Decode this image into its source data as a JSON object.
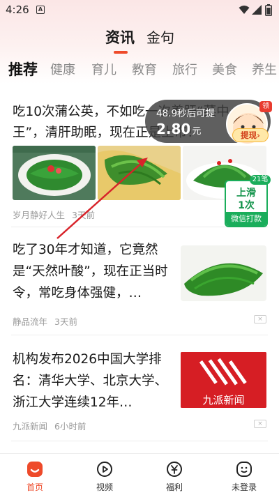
{
  "status_bar": {
    "time": "4:26",
    "notification_letter": "A"
  },
  "header": {
    "tabs": [
      "资讯",
      "金句"
    ],
    "active_tab": "资讯"
  },
  "categories": [
    "推荐",
    "健康",
    "育儿",
    "教育",
    "旅行",
    "美食",
    "养生"
  ],
  "active_category": "推荐",
  "articles": [
    {
      "title": "吃10次蒲公英，不如吃一次养肝“菜中王”，清肝助眠，现在正是上市！",
      "source": "岁月静好人生",
      "time": "3天前"
    },
    {
      "title": "吃了30年才知道，它竟然是“天然叶酸”，现在正当时令，常吃身体强健，…",
      "source": "静品流年",
      "time": "3天前",
      "close_label": "×"
    },
    {
      "title": "机构发布2026中国大学排名：清华大学、北京大学、浙江大学连续12年…",
      "source": "九派新闻",
      "time": "6小时前",
      "close_label": "×",
      "thumb_text": "九派新闻"
    }
  ],
  "timer_overlay": {
    "countdown_text": "48.9秒后可提",
    "amount": "2.80",
    "unit": "元",
    "badge": "领",
    "withdraw_label": "提现",
    "withdraw_arrow": "›"
  },
  "slide_card": {
    "count": "21笔",
    "line1": "上滑",
    "line2": "1次",
    "footer": "微信打款"
  },
  "bottom_nav": [
    {
      "label": "首页",
      "icon": "home-icon",
      "active": true
    },
    {
      "label": "视频",
      "icon": "video-play-icon",
      "active": false
    },
    {
      "label": "福利",
      "icon": "yen-coin-icon",
      "active": false
    },
    {
      "label": "未登录",
      "icon": "smiley-profile-icon",
      "active": false
    }
  ],
  "colors": {
    "accent": "#ee4a2a",
    "green": "#1aad5b",
    "annotation_red": "#d8232a"
  }
}
